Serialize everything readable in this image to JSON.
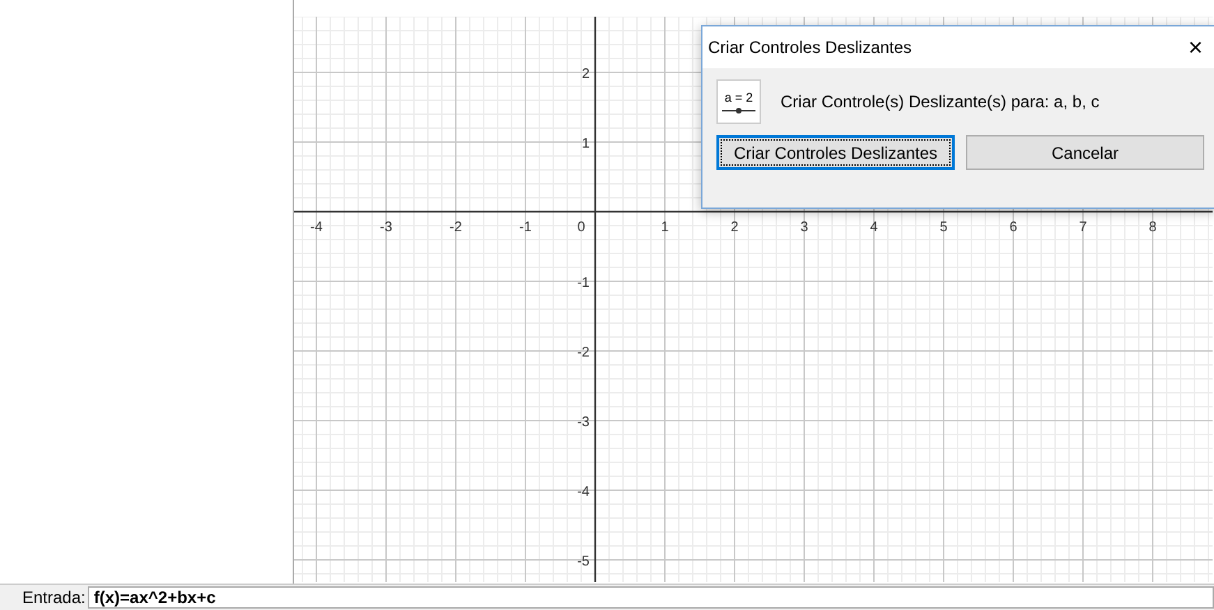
{
  "graphics": {
    "x_axis_labels": [
      "-4",
      "-3",
      "-2",
      "-1",
      "0",
      "1",
      "2",
      "3",
      "4",
      "5",
      "6",
      "7",
      "8"
    ],
    "y_axis_labels": [
      "2",
      "1",
      "-1",
      "-2",
      "-3",
      "-4",
      "-5"
    ]
  },
  "dialog": {
    "title": "Criar Controles Deslizantes",
    "close": "×",
    "message": "Criar Controle(s) Deslizante(s) para: a, b, c",
    "icon_label": "a = 2",
    "buttons": [
      {
        "label": "Criar Controles Deslizantes",
        "focused": true
      },
      {
        "label": "Cancelar",
        "focused": false
      }
    ]
  },
  "input_bar": {
    "label": "Entrada:",
    "value": "f(x)=ax^2+bx+c"
  }
}
